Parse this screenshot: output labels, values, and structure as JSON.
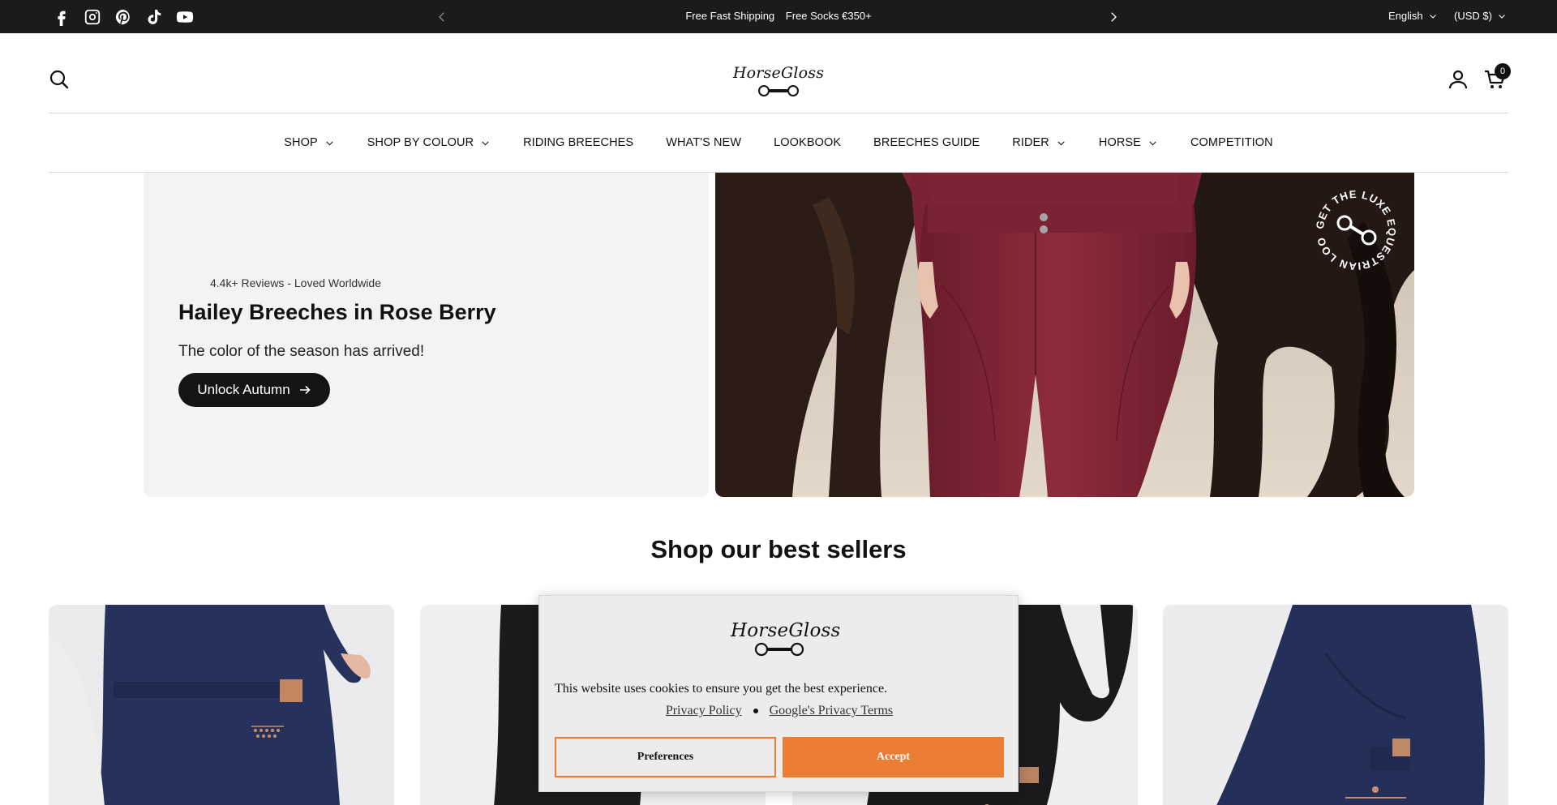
{
  "announcement": {
    "items": [
      "Free Fast Shipping",
      "Free Socks €350+"
    ],
    "language": "English",
    "currency": "(USD $)"
  },
  "header": {
    "logo_text": "HorseGloss",
    "cart_count": "0"
  },
  "nav": {
    "items": [
      {
        "label": "SHOP",
        "dropdown": true
      },
      {
        "label": "SHOP BY COLOUR",
        "dropdown": true
      },
      {
        "label": "RIDING BREECHES",
        "dropdown": false
      },
      {
        "label": "WHAT'S NEW",
        "dropdown": false
      },
      {
        "label": "LOOKBOOK",
        "dropdown": false
      },
      {
        "label": "BREECHES GUIDE",
        "dropdown": false
      },
      {
        "label": "RIDER",
        "dropdown": true
      },
      {
        "label": "HORSE",
        "dropdown": true
      },
      {
        "label": "COMPETITION",
        "dropdown": false
      }
    ]
  },
  "hero": {
    "reviews": "4.4k+ Reviews - Loved Worldwide",
    "title": "Hailey Breeches in Rose Berry",
    "subtitle": "The color of the season has arrived!",
    "cta": "Unlock Autumn",
    "badge_text": "GET THE LUXE EQUESTRIAN LOOK -"
  },
  "best_sellers": {
    "title": "Shop our best sellers"
  },
  "cookie": {
    "logo_text": "HorseGloss",
    "message": "This website uses cookies to ensure you get the best experience.",
    "privacy_link": "Privacy Policy",
    "google_link": "Google's Privacy Terms",
    "preferences": "Preferences",
    "accept": "Accept"
  },
  "colors": {
    "topbar": "#1b1b1b",
    "accent": "#ec7d35",
    "breeches": "#7a2433",
    "navy": "#24305a"
  }
}
